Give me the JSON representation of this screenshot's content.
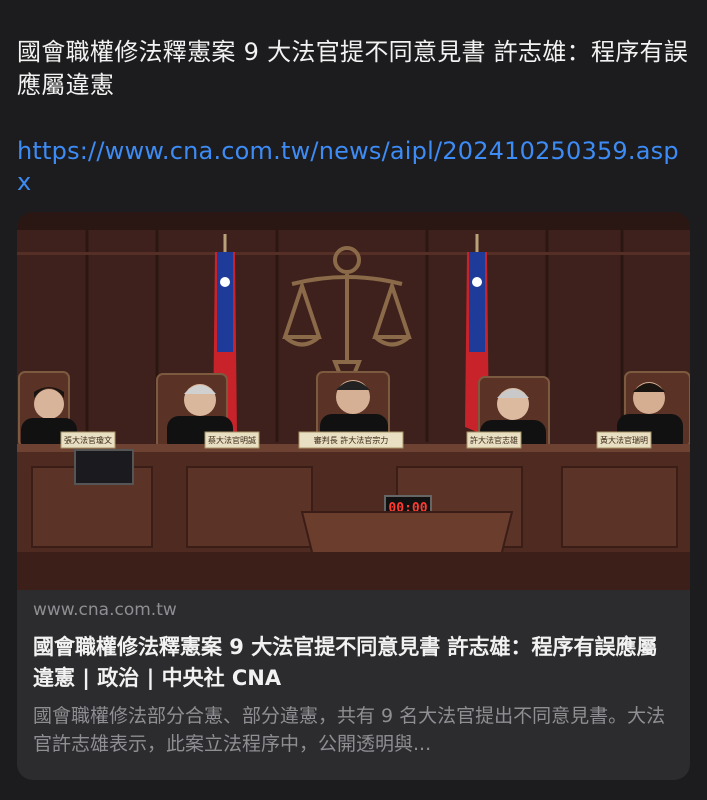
{
  "message": {
    "text": "國會職權修法釋憲案 9 大法官提不同意見書 許志雄：程序有誤應屬違憲",
    "link": "https://www.cna.com.tw/news/aipl/202410250359.aspx"
  },
  "preview": {
    "domain": "www.cna.com.tw",
    "title": "國會職權修法釋憲案 9 大法官提不同意見書 許志雄：程序有誤應屬違憲 | 政治 | 中央社 CNA",
    "description": "國會職權修法部分合憲、部分違憲，共有 9 名大法官提出不同意見書。大法官許志雄表示，此案立法程序中，公開透明與...",
    "image": {
      "nameplates": [
        "張大法官瓊文",
        "蔡大法官明誠",
        "審判長 許大法官宗力",
        "許大法官志雄",
        "黃大法官瑞明"
      ],
      "clock": "00:00"
    }
  },
  "colors": {
    "background": "#1c1c1e",
    "card": "#2c2c2e",
    "link": "#3d8bf5",
    "secondary_text": "#8e8e93"
  }
}
